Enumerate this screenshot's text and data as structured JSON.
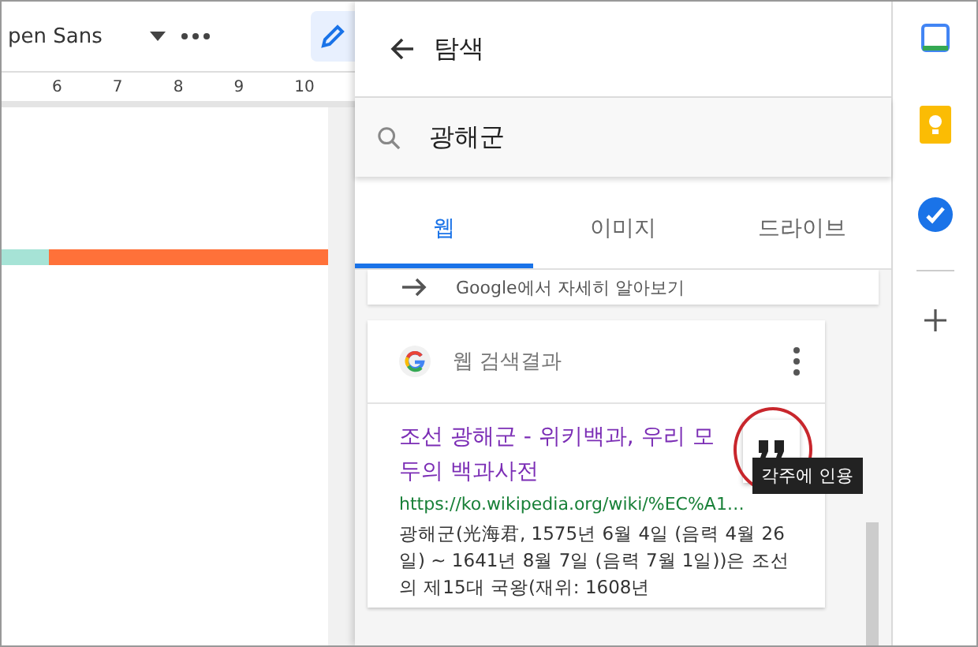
{
  "toolbar": {
    "font": "pen Sans"
  },
  "ruler": {
    "ticks": [
      "6",
      "7",
      "8",
      "9",
      "10"
    ]
  },
  "color_bar": {
    "segments": [
      {
        "color": "#a6e3d6"
      },
      {
        "color": "#ff7139"
      }
    ]
  },
  "panel": {
    "title": "탐색",
    "search": {
      "value": "광해군"
    },
    "tabs": [
      {
        "label": "웹",
        "selected": true
      },
      {
        "label": "이미지",
        "selected": false
      },
      {
        "label": "드라이브",
        "selected": false
      }
    ],
    "more_link": "Google에서 자세히 알아보기",
    "card": {
      "heading": "웹 검색결과",
      "result": {
        "title": "조선 광해군 - 위키백과, 우리 모두의 백과사전",
        "url": "https://ko.wikipedia.org/wiki/%EC%A1…",
        "snippet": "광해군(光海君, 1575년 6월 4일 (음력 4월 26일) ~ 1641년 8월 7일 (음력 7월 1일))은 조선의 제15대 국왕(재위: 1608년"
      }
    },
    "tooltip": "각주에 인용"
  }
}
